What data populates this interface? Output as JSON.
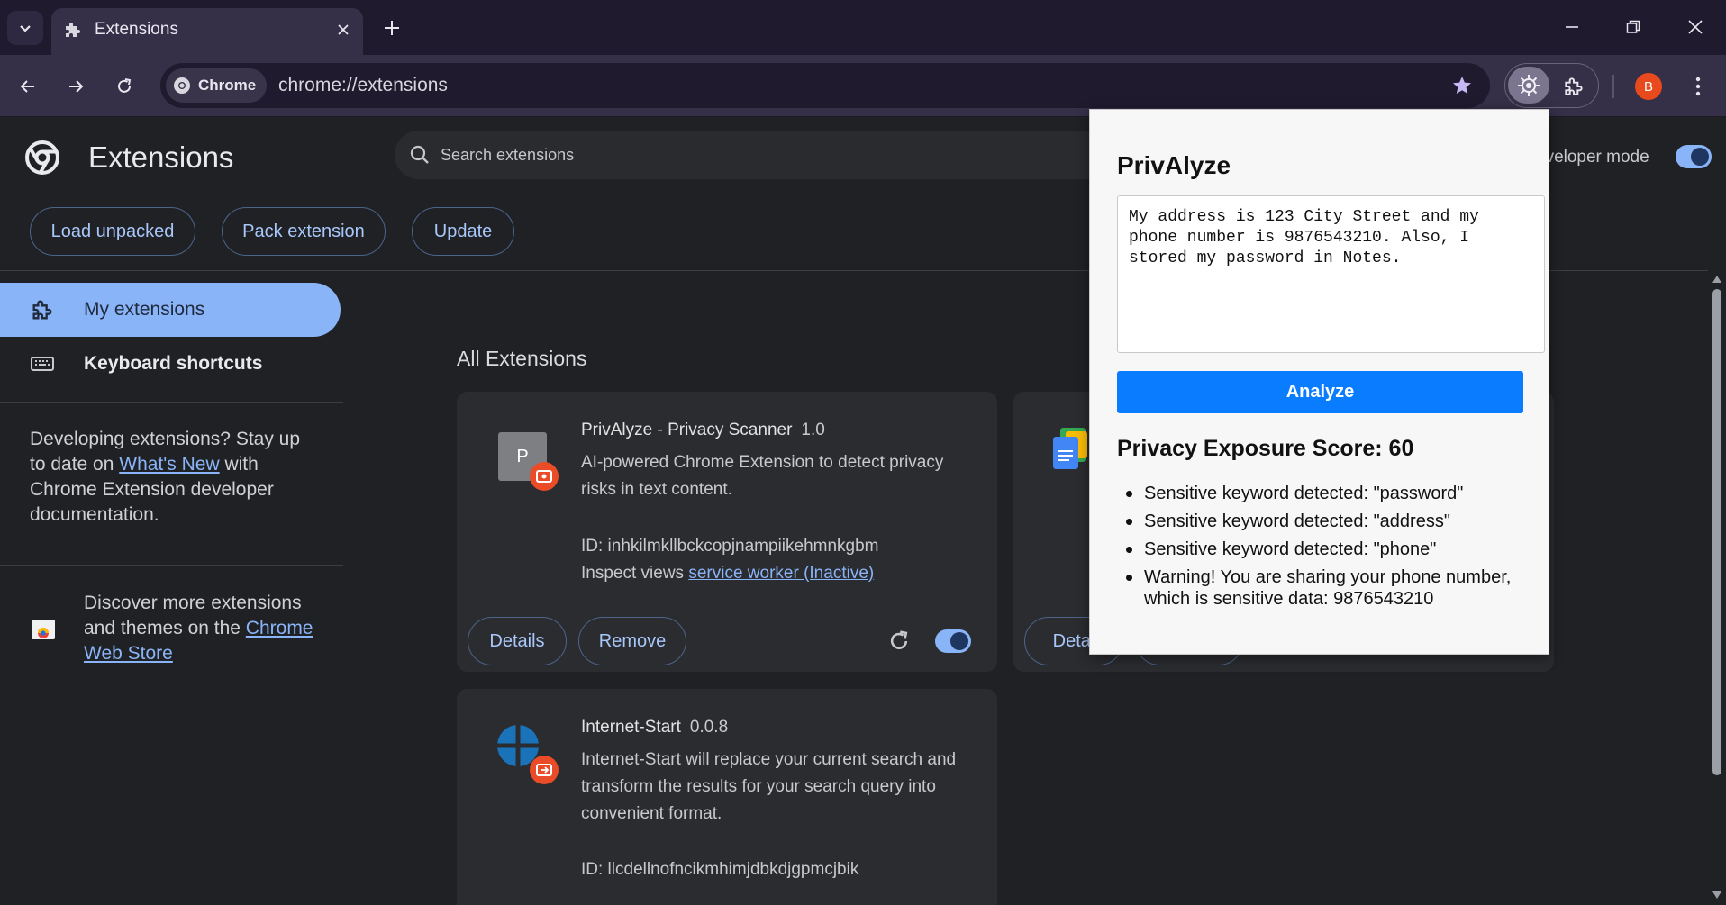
{
  "tab": {
    "title": "Extensions"
  },
  "toolbar": {
    "chip_label": "Chrome",
    "url": "chrome://extensions",
    "avatar_letter": "B"
  },
  "header": {
    "title": "Extensions",
    "search_placeholder": "Search extensions",
    "dev_mode_label": "eveloper mode",
    "dev_mode_on": true,
    "buttons": [
      "Load unpacked",
      "Pack extension",
      "Update"
    ]
  },
  "sidebar": {
    "items": [
      {
        "label": "My extensions",
        "active": true
      },
      {
        "label": "Keyboard shortcuts",
        "active": false
      }
    ],
    "dev_text_before": "Developing extensions? Stay up to date on ",
    "dev_link": "What's New",
    "dev_text_after": " with Chrome Extension developer documentation.",
    "store_text": "Discover more extensions and themes on the ",
    "store_link": "Chrome Web Store"
  },
  "main": {
    "section_title": "All Extensions",
    "extensions": [
      {
        "name": "PrivAlyze - Privacy Scanner",
        "version": "1.0",
        "icon_letter": "P",
        "description": "AI-powered Chrome Extension to detect privacy risks in text content.",
        "id_label": "ID: inhkilmkllbckcopjnampiikehmnkgbm",
        "inspect_label": "Inspect views",
        "inspect_link": "service worker (Inactive)",
        "details_label": "Details",
        "remove_label": "Remove",
        "enabled": true
      },
      {
        "name": "Internet-Start",
        "version": "0.0.8",
        "description": "Internet-Start will replace your current search and transform the results for your search query into convenient format.",
        "id_label": "ID: llcdellnofncikmhimjdbkdjgpmcjbik"
      },
      {
        "details_label": "Detai"
      }
    ]
  },
  "popup": {
    "title": "PrivAlyze",
    "input_text": "My address is 123 City Street and my phone number is 9876543210. Also, I stored my password in Notes.",
    "analyze_label": "Analyze",
    "score_label": "Privacy Exposure Score: 60",
    "results": [
      "Sensitive keyword detected: \"password\"",
      "Sensitive keyword detected: \"address\"",
      "Sensitive keyword detected: \"phone\"",
      "Warning! You are sharing your phone number, which is sensitive data: 9876543210"
    ]
  },
  "colors": {
    "accent": "#8ab4f8",
    "popup_button": "#0a7cff",
    "background": "#202124",
    "card": "#2b2c30"
  }
}
